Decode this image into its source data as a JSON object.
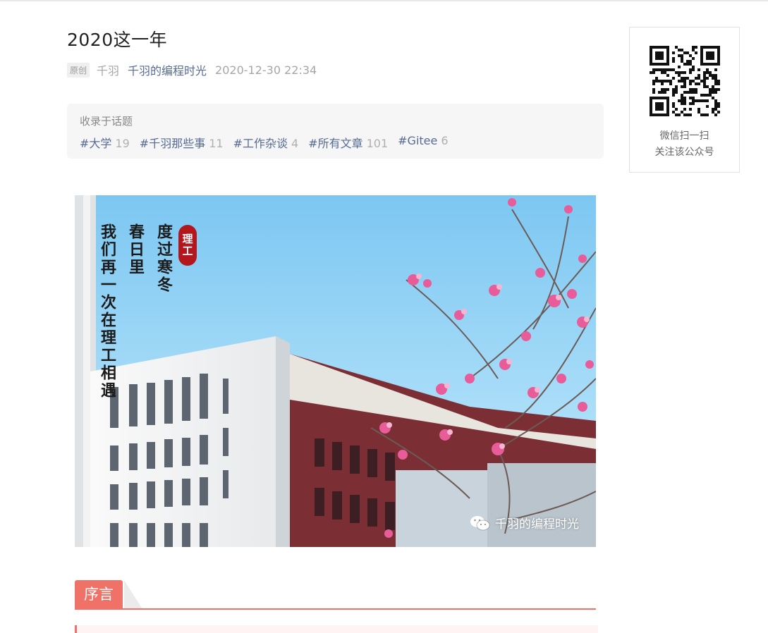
{
  "article": {
    "title": "2020这一年",
    "original_badge": "原创",
    "author": "千羽",
    "account": "千羽的编程时光",
    "date": "2020-12-30 22:34"
  },
  "topics": {
    "label": "收录于话题",
    "items": [
      {
        "name": "#大学",
        "count": "19"
      },
      {
        "name": "#千羽那些事",
        "count": "11"
      },
      {
        "name": "#工作杂谈",
        "count": "4"
      },
      {
        "name": "#所有文章",
        "count": "101"
      },
      {
        "name": "#Gitee",
        "count": "6"
      }
    ]
  },
  "qr": {
    "line1": "微信扫一扫",
    "line2": "关注该公众号",
    "icon": "qr-code-icon"
  },
  "cover": {
    "poem_col1": "度过寒冬",
    "poem_col2": "春日里",
    "poem_col3": "我们再一次在理工相遇",
    "seal_text": "理工",
    "watermark": "千羽的编程时光",
    "watermark_icon": "wechat-icon"
  },
  "section": {
    "heading": "序言",
    "accent": "#f07167"
  },
  "colors": {
    "link": "#576b95",
    "muted": "#a6a6a6",
    "accent": "#f07167"
  }
}
